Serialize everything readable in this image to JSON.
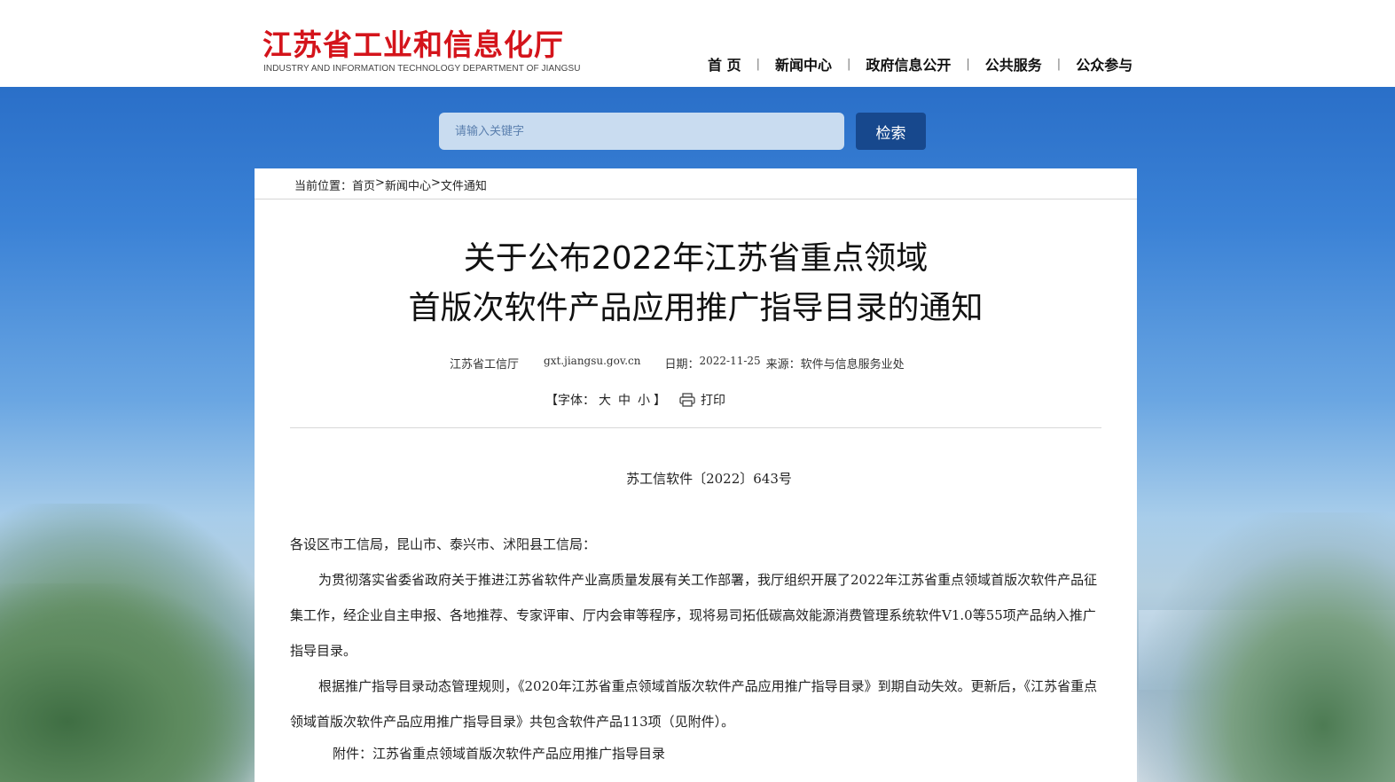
{
  "header": {
    "logo_title": "江苏省工业和信息化厅",
    "logo_subtitle": "INDUSTRY AND INFORMATION TECHNOLOGY DEPARTMENT OF JIANGSU",
    "nav": [
      "首 页",
      "新闻中心",
      "政府信息公开",
      "公共服务",
      "公众参与"
    ],
    "nav_separator": "|"
  },
  "search": {
    "placeholder": "请输入关键字",
    "button_label": "检索"
  },
  "breadcrumb": {
    "prefix": "当前位置：",
    "items": [
      "首页",
      "新闻中心",
      "文件通知"
    ],
    "separator": ">"
  },
  "article": {
    "title_line1": "关于公布2022年江苏省重点领域",
    "title_line2": "首版次软件产品应用推广指导目录的通知",
    "meta_publisher": "江苏省工信厅",
    "meta_site": "gxt.jiangsu.gov.cn",
    "meta_date_label": "日期：",
    "meta_date": "2022-11-25",
    "meta_source_label": "来源：",
    "meta_source": "软件与信息服务业处",
    "font_label_open": "【字体：",
    "font_sizes": [
      "大",
      "中",
      "小"
    ],
    "font_label_close": "】",
    "print_label": "打印",
    "doc_number": "苏工信软件〔2022〕643号",
    "greeting": "各设区市工信局，昆山市、泰兴市、沭阳县工信局：",
    "paragraph1": "为贯彻落实省委省政府关于推进江苏省软件产业高质量发展有关工作部署，我厅组织开展了2022年江苏省重点领域首版次软件产品征集工作，经企业自主申报、各地推荐、专家评审、厅内会审等程序，现将易司拓低碳高效能源消费管理系统软件V1.0等55项产品纳入推广指导目录。",
    "paragraph2": "根据推广指导目录动态管理规则，《2020年江苏省重点领域首版次软件产品应用推广指导目录》到期自动失效。更新后，《江苏省重点领域首版次软件产品应用推广指导目录》共包含软件产品113项（见附件）。",
    "attachment": "附件：江苏省重点领域首版次软件产品应用推广指导目录"
  },
  "colors": {
    "logo_red": "#d4141b",
    "search_button": "#17488d",
    "search_input_bg": "#c9dcf0"
  },
  "icons": [
    "printer-icon"
  ]
}
